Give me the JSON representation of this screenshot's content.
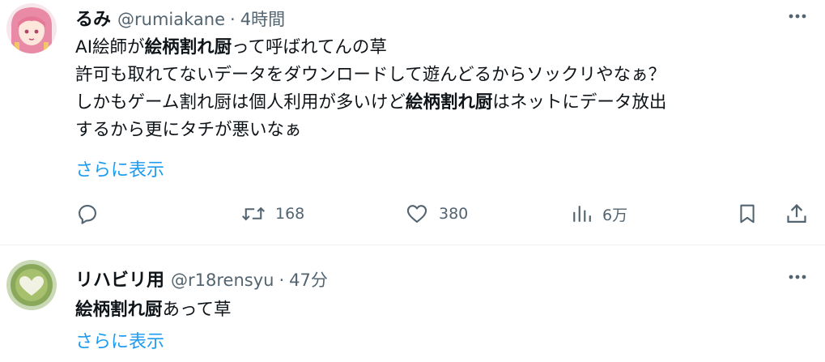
{
  "tweets": [
    {
      "name": "るみ",
      "handle": "@rumiakane",
      "separator": "·",
      "time": "4時間",
      "lines": [
        [
          "AI絵師が",
          "絵柄割れ厨",
          "って呼ばれてんの草"
        ],
        [
          "許可も取れてないデータをダウンロードして遊んどるからソックリやなぁ？"
        ],
        [
          "しかもゲーム割れ厨は個人利用が多いけど",
          "絵柄割れ厨",
          "はネットにデータ放出"
        ],
        [
          "するから更にタチが悪いなぁ"
        ]
      ],
      "show_more": "さらに表示",
      "stats": {
        "reply": "",
        "retweets": "168",
        "likes": "380",
        "views": "6万"
      }
    },
    {
      "name": "リハビリ用",
      "handle": "@r18rensyu",
      "separator": "·",
      "time": "47分",
      "lines": [
        [
          "",
          "絵柄割れ厨",
          "あって草"
        ]
      ],
      "show_more": "さらに表示"
    }
  ],
  "icons": {
    "more": "more-dots-icon",
    "reply": "reply-bubble-icon",
    "retweet": "retweet-icon",
    "like": "heart-icon",
    "views": "analytics-bars-icon",
    "bookmark": "bookmark-icon",
    "share": "share-upload-icon"
  },
  "colors": {
    "text": "#0f1419",
    "secondary": "#536471",
    "link": "#1d9bf0",
    "divider": "#eff3f4"
  }
}
